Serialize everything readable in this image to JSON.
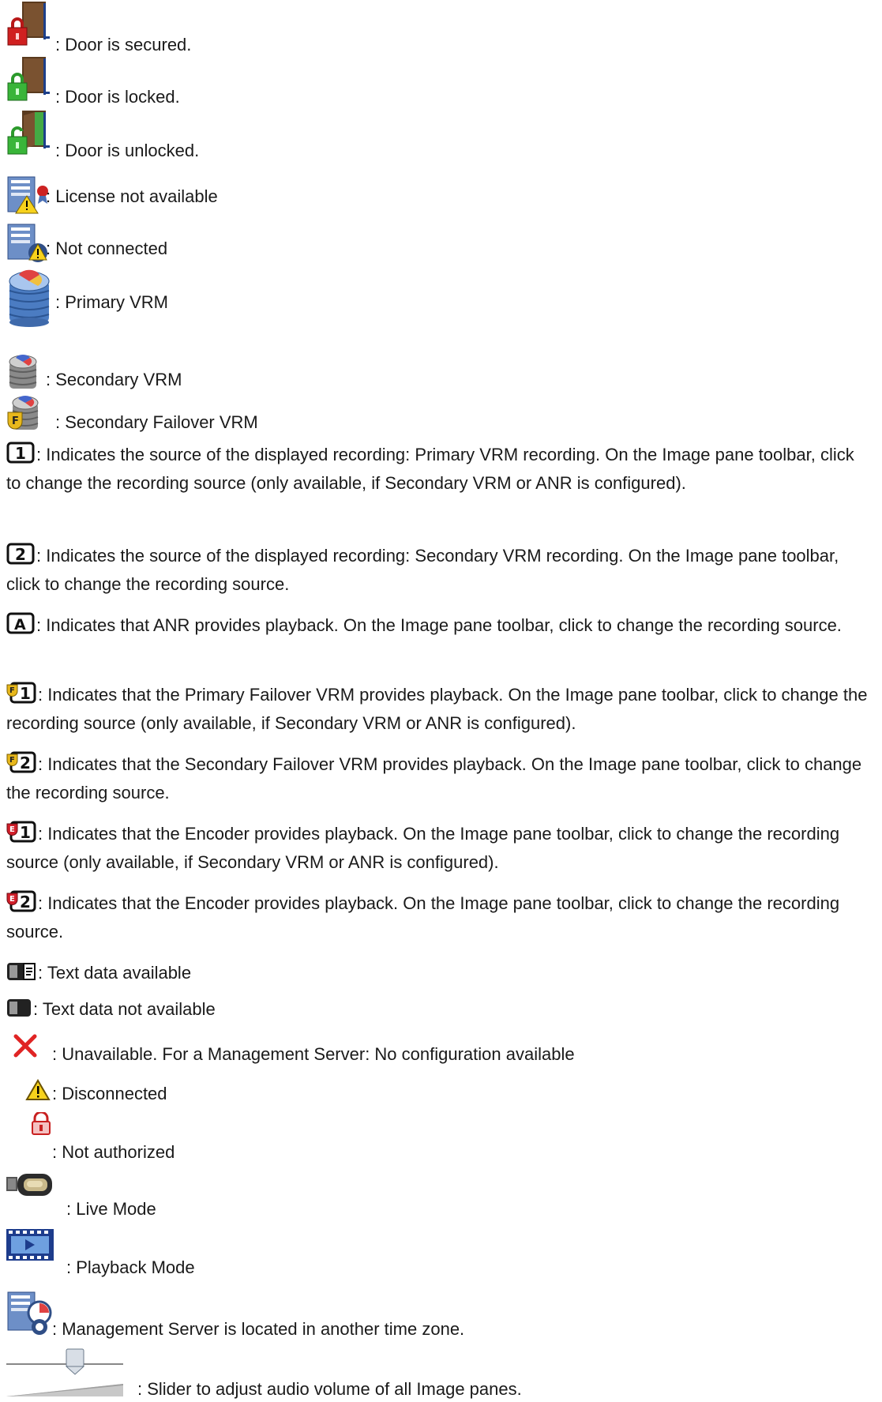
{
  "entries": [
    {
      "icon": "door-secured-icon",
      "text": ": Door is secured."
    },
    {
      "icon": "door-locked-icon",
      "text": ": Door is locked."
    },
    {
      "icon": "door-unlocked-icon",
      "text": ": Door is unlocked."
    },
    {
      "icon": "license-not-available-icon",
      "text": ": License not available"
    },
    {
      "icon": "not-connected-icon",
      "text": ": Not connected"
    },
    {
      "icon": "primary-vrm-icon",
      "text": ": Primary VRM"
    },
    {
      "icon": "secondary-vrm-icon",
      "text": ": Secondary VRM"
    },
    {
      "icon": "secondary-failover-vrm-icon",
      "text": ": Secondary Failover VRM"
    },
    {
      "icon": "source-1-icon",
      "text": ": Indicates the source of the displayed recording: Primary VRM recording. On the Image pane toolbar, click to change the recording source (only available, if Secondary VRM or ANR is configured)."
    },
    {
      "icon": "source-2-icon",
      "text": ": Indicates the source of the displayed recording: Secondary VRM recording. On the Image pane toolbar, click to change the recording source."
    },
    {
      "icon": "source-anr-icon",
      "text": ": Indicates that ANR provides playback. On the Image pane toolbar, click to change the recording source."
    },
    {
      "icon": "failover-1-icon",
      "text": ": Indicates that the Primary Failover VRM provides playback. On the Image pane toolbar, click to change the recording source (only available, if Secondary VRM or ANR is configured)."
    },
    {
      "icon": "failover-2-icon",
      "text": ": Indicates that the Secondary Failover VRM provides playback. On the Image pane toolbar, click to change the recording source."
    },
    {
      "icon": "encoder-1-icon",
      "text": ": Indicates that the Encoder provides playback. On the Image pane toolbar, click to change the recording source (only available, if Secondary VRM or ANR is configured)."
    },
    {
      "icon": "encoder-2-icon",
      "text": ": Indicates that the Encoder provides playback. On the Image pane toolbar, click to change the recording source."
    },
    {
      "icon": "text-data-available-icon",
      "text": ": Text data available"
    },
    {
      "icon": "text-data-not-available-icon",
      "text": ": Text data not available"
    },
    {
      "icon": "unavailable-x-icon",
      "text": ": Unavailable. For a Management Server: No configuration available"
    },
    {
      "icon": "disconnected-warning-icon",
      "text": ": Disconnected"
    },
    {
      "icon": "not-authorized-lock-icon",
      "text": ": Not authorized"
    },
    {
      "icon": "live-mode-camera-icon",
      "text": ": Live Mode"
    },
    {
      "icon": "playback-mode-film-icon",
      "text": ": Playback Mode"
    },
    {
      "icon": "management-server-timezone-icon",
      "text": ": Management Server is located in another time zone."
    },
    {
      "icon": "audio-volume-slider-icon",
      "text": ": Slider to adjust audio volume of all Image panes."
    }
  ]
}
